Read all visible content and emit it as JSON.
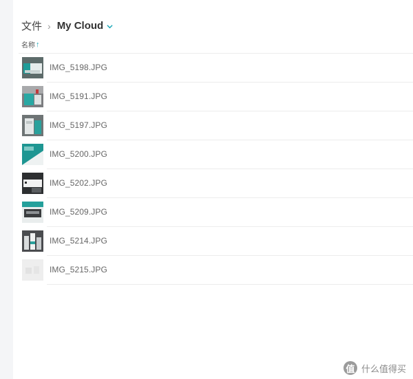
{
  "breadcrumb": {
    "root": "文件",
    "separator": "›",
    "current": "My Cloud"
  },
  "list_header": {
    "name_column": "名称",
    "sort_arrow": "↑"
  },
  "files": [
    {
      "name": "IMG_5198.JPG"
    },
    {
      "name": "IMG_5191.JPG"
    },
    {
      "name": "IMG_5197.JPG"
    },
    {
      "name": "IMG_5200.JPG"
    },
    {
      "name": "IMG_5202.JPG"
    },
    {
      "name": "IMG_5209.JPG"
    },
    {
      "name": "IMG_5214.JPG"
    },
    {
      "name": "IMG_5215.JPG"
    }
  ],
  "watermark": {
    "icon_glyph": "值",
    "text": "什么值得买"
  },
  "colors": {
    "accent": "#1aa7b8",
    "rail": "#f4f5f7",
    "divider": "#ececec"
  }
}
